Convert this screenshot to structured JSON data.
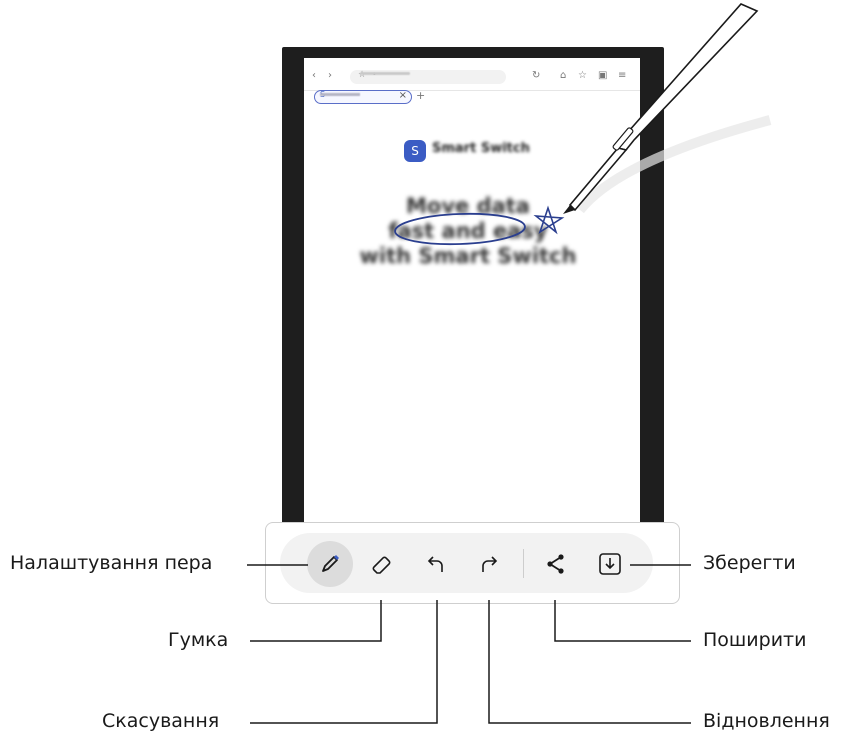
{
  "labels": {
    "pen_settings": "Налаштування пера",
    "eraser": "Гумка",
    "undo": "Скасування",
    "save": "Зберегти",
    "share": "Поширити",
    "redo": "Відновлення"
  },
  "colors": {
    "accent": "#3b5cc4",
    "toolbar_bg": "#f2f2f2",
    "selected_tool_bg": "#dcdcdc",
    "device_frame": "#1e1e1e"
  },
  "icons": {
    "pen_settings": "pen-icon",
    "eraser": "eraser-icon",
    "undo": "undo-arrow-icon",
    "redo": "redo-arrow-icon",
    "share": "share-icon",
    "save": "save-download-icon"
  }
}
